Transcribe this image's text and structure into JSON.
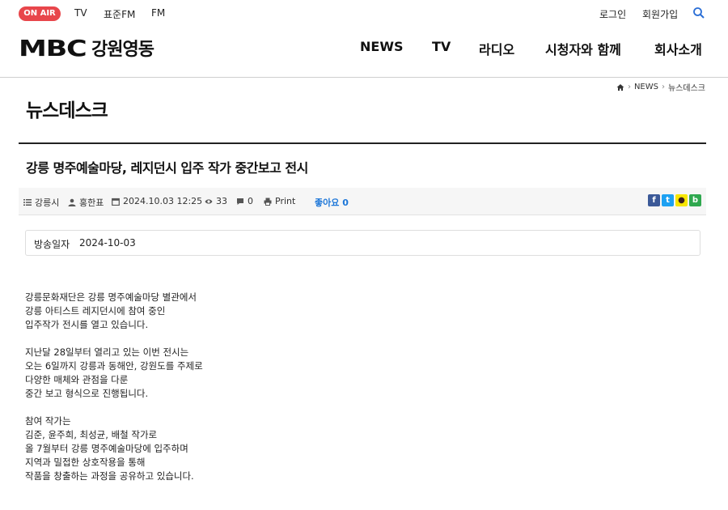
{
  "topbar": {
    "onair": "ON AIR",
    "links": [
      "TV",
      "표준FM",
      "FM"
    ],
    "login": "로그인",
    "signup": "회원가입"
  },
  "header": {
    "logo_mbc": "MBC",
    "logo_local": "강원영동",
    "nav": [
      "NEWS",
      "TV",
      "라디오",
      "시청자와 함께",
      "회사소개"
    ]
  },
  "breadcrumb": [
    "NEWS",
    "뉴스데스크"
  ],
  "page_title": "뉴스데스크",
  "article": {
    "title": "강릉 명주예술마당, 레지던시 입주 작가 중간보고 전시",
    "meta": {
      "category": "강릉시",
      "author": "홍한표",
      "datetime": "2024.10.03 12:25",
      "views": "33",
      "comments": "0",
      "print": "Print",
      "like_label": "좋아요",
      "like_count": "0"
    },
    "broadcast_label": "방송일자",
    "broadcast_date": "2024-10-03",
    "paragraphs": [
      [
        "강릉문화재단은 강릉 명주예술마당 별관에서",
        "강릉 아티스트 레지던시에 참여 중인",
        "입주작가 전시를 열고 있습니다."
      ],
      [
        "지난달 28일부터 열리고 있는 이번 전시는",
        "오는 6일까지 강릉과 동해안, 강원도를 주제로",
        "다양한 매체와 관점을 다룬",
        "중간 보고 형식으로 진행됩니다."
      ],
      [
        "참여 작가는",
        "김준, 윤주희, 최성균, 배철 작가로",
        "올 7월부터 강릉 명주예술마당에 입주하며",
        "지역과 밀접한 상호작용을 통해",
        "작품을 창출하는 과정을 공유하고 있습니다."
      ]
    ]
  },
  "colors": {
    "onair": "#e8464b",
    "like": "#1c76d8",
    "facebook": "#3b5998",
    "twitter": "#1da1f2",
    "kakao": "#f7e600",
    "band": "#2fa84f"
  }
}
